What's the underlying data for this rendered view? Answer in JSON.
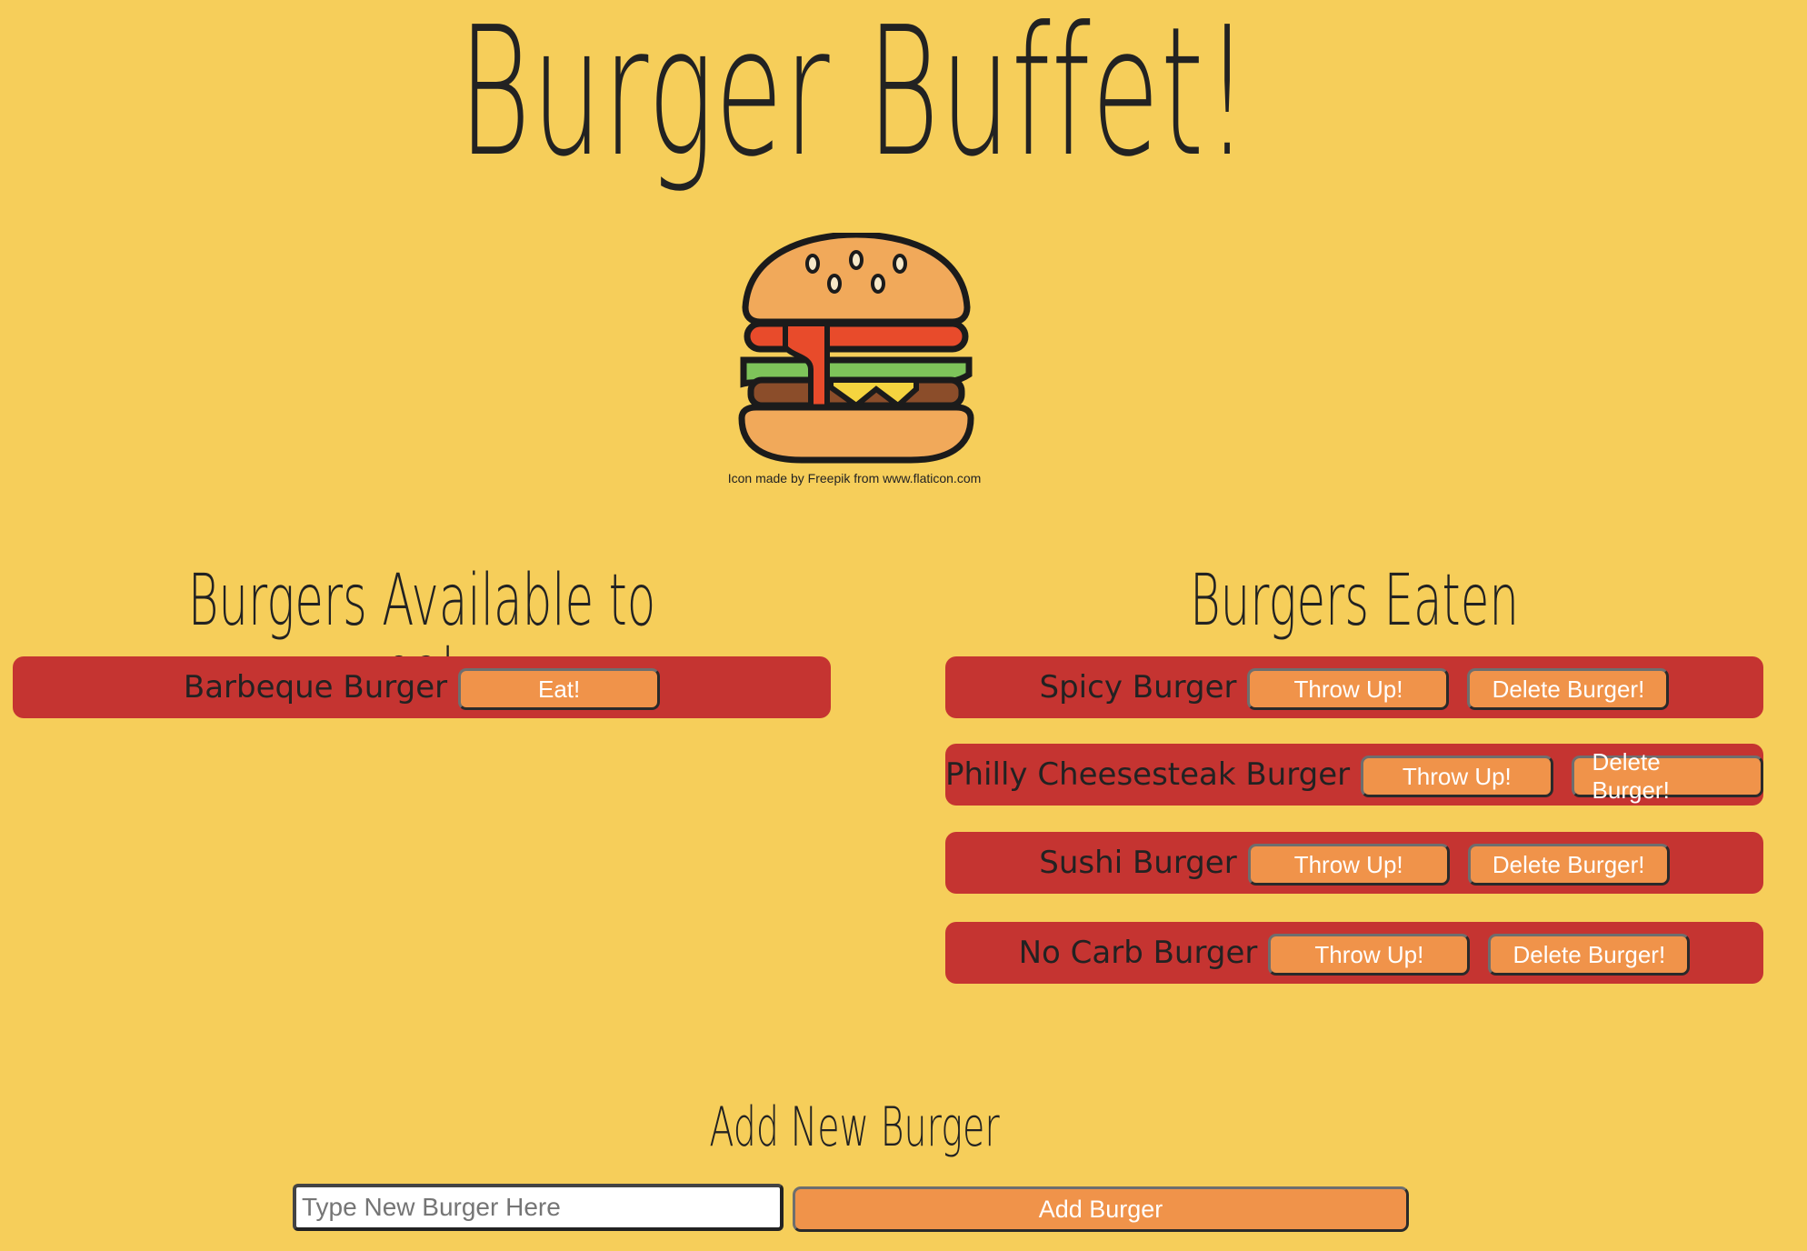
{
  "header": {
    "title": "Burger Buffet!",
    "logo_icon": "burger-icon",
    "credit": "Icon made by Freepik from www.flaticon.com"
  },
  "available": {
    "heading": "Burgers Available to eat",
    "items": [
      {
        "name": "Barbeque Burger",
        "eat_label": "Eat!"
      }
    ]
  },
  "eaten": {
    "heading": "Burgers Eaten",
    "items": [
      {
        "name": "Spicy Burger",
        "throw_label": "Throw Up!",
        "delete_label": "Delete Burger!"
      },
      {
        "name": "Philly Cheesesteak Burger",
        "throw_label": "Throw Up!",
        "delete_label": "Delete Burger!"
      },
      {
        "name": "Sushi Burger",
        "throw_label": "Throw Up!",
        "delete_label": "Delete Burger!"
      },
      {
        "name": "No Carb Burger",
        "throw_label": "Throw Up!",
        "delete_label": "Delete Burger!"
      }
    ]
  },
  "add_form": {
    "heading": "Add New Burger",
    "input_placeholder": "Type New Burger Here",
    "input_value": "",
    "button_label": "Add Burger"
  },
  "colors": {
    "background": "#f6ce5a",
    "row": "#c53431",
    "button": "#f0934a"
  }
}
